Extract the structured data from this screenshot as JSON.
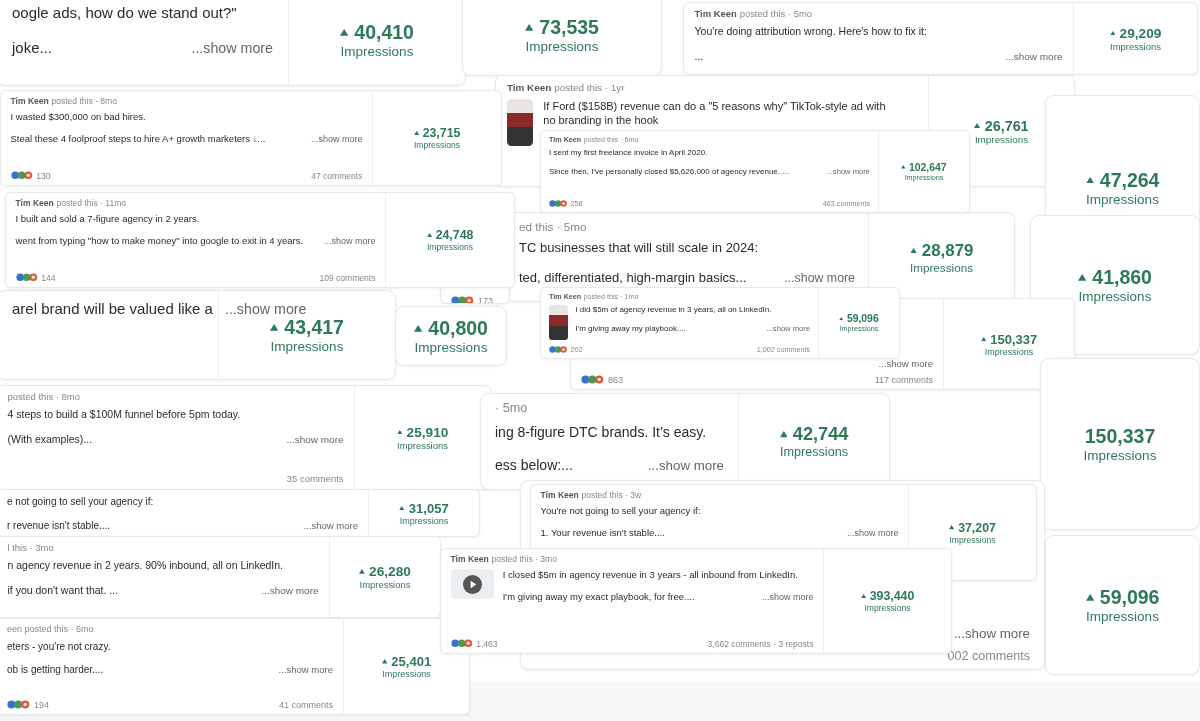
{
  "cards": [
    {
      "lines": [
        "oogle ads, how do we stand out?\"",
        "joke..."
      ],
      "show_more": "...show more",
      "impressions": {
        "value": "40,410",
        "label": "Impressions",
        "trend_up": true
      }
    },
    {
      "impressions": {
        "value": "73,535",
        "label": "Impressions",
        "trend_up": true
      }
    },
    {
      "author": "Tim Keen",
      "meta": "posted this · 5mo",
      "lines": [
        "You're doing attribution wrong. Here's how to fix it:",
        "..."
      ],
      "show_more": "...show more",
      "impressions": {
        "value": "29,209",
        "label": "Impressions",
        "trend_up": true
      }
    },
    {
      "author": "Tim Keen",
      "meta": "posted this · 1yr",
      "thumbnail": {
        "kind": "image"
      },
      "lines": [
        "If Ford ($158B) revenue can do a \"5 reasons why\" TikTok-style ad with\nno branding in the hook"
      ],
      "impressions": {
        "value": "26,761",
        "label": "Impressions",
        "trend_up": true
      }
    },
    {
      "impressions": {
        "value": "47,264",
        "label": "Impressions",
        "trend_up": true
      }
    },
    {
      "meta": "ed this · 5mo",
      "lines": [
        "TC businesses that will still scale in 2024:",
        "ted, differentiated, high-margin basics..."
      ],
      "show_more": "...show more",
      "impressions": {
        "value": "28,879",
        "label": "Impressions",
        "trend_up": true
      }
    },
    {
      "impressions": {
        "value": "41,860",
        "label": "Impressions",
        "trend_up": true
      }
    },
    {
      "lines": [
        "arel brand will be valued like a"
      ],
      "show_more": "...show more",
      "impressions": {
        "value": "43,417",
        "label": "Impressions",
        "trend_up": true
      }
    },
    {
      "reactions": "173"
    },
    {
      "impressions": {
        "value": "40,800",
        "label": "Impressions",
        "trend_up": true
      }
    },
    {
      "show_more": "...show more",
      "reactions": "863",
      "comments": "117 comments",
      "impressions": {
        "value": "150,337",
        "label": "Impressions",
        "trend_up": true
      }
    },
    {
      "impressions": {
        "value": "150,337",
        "label": "Impressions",
        "trend_up": false
      }
    },
    {
      "meta": "posted this · 8mo",
      "lines": [
        "4 steps to build a $100M funnel before 5pm today.",
        "(With examples)..."
      ],
      "show_more": "...show more",
      "comments": "35 comments",
      "impressions": {
        "value": "25,910",
        "label": "Impressions",
        "trend_up": true
      }
    },
    {
      "meta": "· 5mo",
      "lines": [
        "ing 8-figure DTC brands. It’s easy.",
        "ess below:..."
      ],
      "show_more": "...show more",
      "impressions": {
        "value": "42,744",
        "label": "Impressions",
        "trend_up": true
      }
    },
    {
      "lines": [
        "e not going to sell your agency if:",
        "r revenue isn't stable...."
      ],
      "show_more": "...show more",
      "impressions": {
        "value": "31,057",
        "label": "Impressions",
        "trend_up": true
      }
    },
    {
      "meta": "l this · 3mo",
      "lines": [
        "n agency revenue in 2 years. 90% inbound, all on LinkedIn.",
        "if you don't want that. ..."
      ],
      "show_more": "...show more",
      "impressions": {
        "value": "26,280",
        "label": "Impressions",
        "trend_up": true
      }
    },
    {
      "meta": "een posted this · 6mo",
      "lines": [
        "eters - you're not crazy.",
        "ob is getting harder...."
      ],
      "show_more": "...show more",
      "reactions": "194",
      "comments": "41 comments",
      "impressions": {
        "value": "25,401",
        "label": "Impressions",
        "trend_up": true
      }
    },
    {
      "show_more": "...show more",
      "comments": "002 comments"
    },
    {
      "impressions": {
        "value": "59,096",
        "label": "Impressions",
        "trend_up": true
      }
    },
    {
      "author": "Tim Keen",
      "meta": "posted this · 3w",
      "lines": [
        "You're not going to sell your agency if:",
        "1. Your revenue isn't stable...."
      ],
      "show_more": "...show more",
      "impressions": {
        "value": "37,207",
        "label": "Impressions",
        "trend_up": true
      }
    },
    {
      "author": "Tim Keen",
      "meta": "posted this · 3mo",
      "thumbnail": {
        "kind": "video"
      },
      "lines": [
        "I closed $5m in agency revenue in 3 years - all inbound from LinkedIn.",
        "I'm giving away my exact playbook, for free...."
      ],
      "show_more": "...show more",
      "reactions": "1,463",
      "comments": "3,662 comments · 3 reposts",
      "impressions": {
        "value": "393,440",
        "label": "Impressions",
        "trend_up": true
      }
    },
    {
      "author": "Tim Keen",
      "meta": "posted this · 8mo",
      "lines": [
        "I wasted $300,000 on bad hires.",
        "Steal these 4 foolproof steps to hire A+ growth marketers ↓..."
      ],
      "show_more": "...show more",
      "reactions": "130",
      "comments": "47 comments",
      "impressions": {
        "value": "23,715",
        "label": "Impressions",
        "trend_up": true
      }
    },
    {
      "author": "Tim Keen",
      "meta": "posted this · 11mo",
      "lines": [
        "I built and sold a 7-figure agency in 2 years.",
        "went from typing \"how to make money\" into google to exit in 4 years."
      ],
      "show_more": "...show more",
      "reactions": "144",
      "comments": "109 comments",
      "impressions": {
        "value": "24,748",
        "label": "Impressions",
        "trend_up": true
      }
    },
    {
      "author": "Tim Keen",
      "meta": "posted this · 6mo",
      "lines": [
        "I sent my first freelance invoice in April 2020.",
        "Since then, I've personally closed $5,626,000 of agency revenue. ..."
      ],
      "show_more": "...show more",
      "reactions": "258",
      "comments": "463 comments",
      "impressions": {
        "value": "102,647",
        "label": "Impressions",
        "trend_up": true
      }
    },
    {
      "author": "Tim Keen",
      "meta": "posted this · 1mo",
      "thumbnail": {
        "kind": "image"
      },
      "lines": [
        "I did $5m of agency revenue in 3 years, all on LinkedIn.",
        "I'm giving away my playbook...."
      ],
      "show_more": "...show more",
      "reactions": "202",
      "comments": "1,002 comments",
      "impressions": {
        "value": "59,096",
        "label": "Impressions",
        "trend_up": true
      }
    }
  ]
}
